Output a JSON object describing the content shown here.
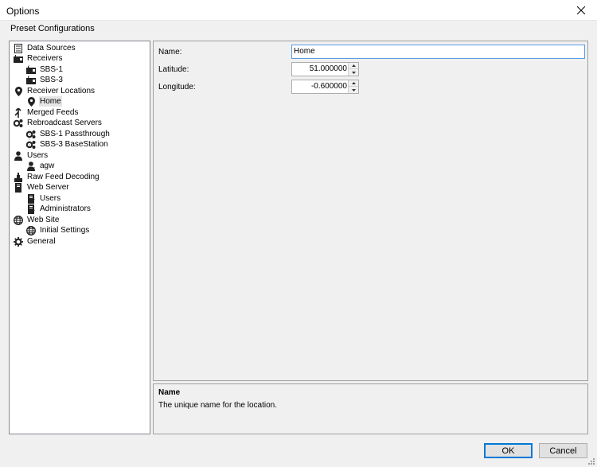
{
  "window": {
    "title": "Options"
  },
  "menu": {
    "item": "Preset Configurations"
  },
  "tree": {
    "data_sources": "Data Sources",
    "receivers": "Receivers",
    "sbs1": "SBS-1",
    "sbs3": "SBS-3",
    "receiver_locations": "Receiver Locations",
    "home": "Home",
    "merged_feeds": "Merged Feeds",
    "rebroadcast_servers": "Rebroadcast Servers",
    "sbs1_passthrough": "SBS-1 Passthrough",
    "sbs3_basestation": "SBS-3 BaseStation",
    "users": "Users",
    "agw": "agw",
    "raw_feed_decoding": "Raw Feed Decoding",
    "web_server": "Web Server",
    "ws_users": "Users",
    "ws_administrators": "Administrators",
    "web_site": "Web Site",
    "initial_settings": "Initial Settings",
    "general": "General"
  },
  "form": {
    "name_label": "Name:",
    "name_value": "Home",
    "latitude_label": "Latitude:",
    "latitude_value": "51.000000",
    "longitude_label": "Longitude:",
    "longitude_value": "-0.600000"
  },
  "help": {
    "title": "Name",
    "description": "The unique name for the location."
  },
  "buttons": {
    "ok": "OK",
    "cancel": "Cancel"
  }
}
